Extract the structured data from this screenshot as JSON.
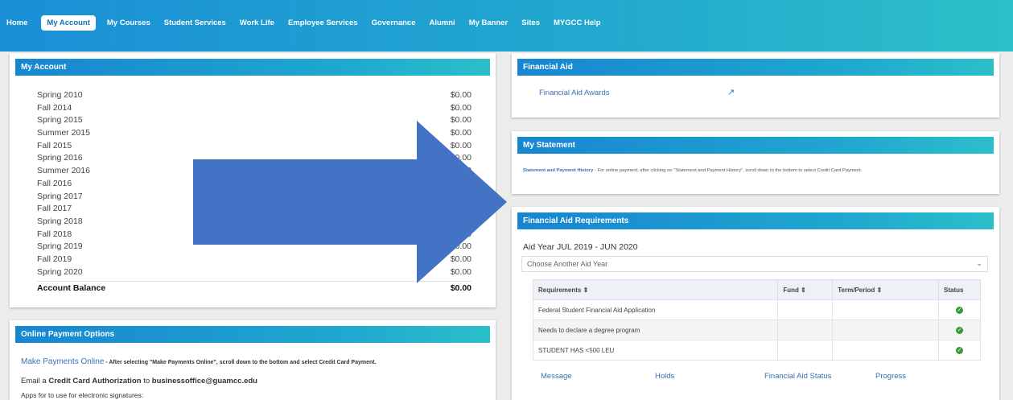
{
  "nav": [
    "Home",
    "My Account",
    "My Courses",
    "Student Services",
    "Work Life",
    "Employee Services",
    "Governance",
    "Alumni",
    "My Banner",
    "Sites",
    "MYGCC Help"
  ],
  "nav_active": "My Account",
  "account": {
    "title": "My Account",
    "terms": [
      {
        "term": "Spring 2010",
        "amount": "$0.00"
      },
      {
        "term": "Fall 2014",
        "amount": "$0.00"
      },
      {
        "term": "Spring 2015",
        "amount": "$0.00"
      },
      {
        "term": "Summer 2015",
        "amount": "$0.00"
      },
      {
        "term": "Fall 2015",
        "amount": "$0.00"
      },
      {
        "term": "Spring 2016",
        "amount": "$0.00"
      },
      {
        "term": "Summer 2016",
        "amount": "$0.00"
      },
      {
        "term": "Fall 2016",
        "amount": "$0.00"
      },
      {
        "term": "Spring 2017",
        "amount": "$0.00"
      },
      {
        "term": "Fall 2017",
        "amount": "$0.00"
      },
      {
        "term": "Spring 2018",
        "amount": "$0.00"
      },
      {
        "term": "Fall 2018",
        "amount": "$0.00"
      },
      {
        "term": "Spring 2019",
        "amount": "$0.00"
      },
      {
        "term": "Fall 2019",
        "amount": "$0.00"
      },
      {
        "term": "Spring 2020",
        "amount": "$0.00"
      }
    ],
    "balance_label": "Account Balance",
    "balance_value": "$0.00"
  },
  "payment": {
    "title": "Online Payment Options",
    "make_payments_link": "Make Payments Online",
    "make_payments_note": " - After selecting \"Make Payments Online\", scroll down to the bottom and select Credit Card Payment.",
    "email_prefix": "Email a ",
    "email_bold": "Credit Card Authorization",
    "email_mid": " to ",
    "email_address": "businessoffice@guamcc.edu",
    "apps_text": "Apps for to use for electronic signatures:"
  },
  "financial_aid": {
    "title": "Financial Aid",
    "awards_link": "Financial Aid Awards"
  },
  "statement": {
    "title": "My Statement",
    "link": "Statement and Payment History",
    "note": " - For online payment, after clicking on \"Statement and Payment History\", scroll down to the bottom to select Credit Card Payment."
  },
  "requirements": {
    "title": "Financial Aid Requirements",
    "aid_year": "Aid Year JUL 2019 - JUN 2020",
    "choose_placeholder": "Choose Another Aid Year",
    "columns": [
      "Requirements ⇕",
      "Fund ⇕",
      "Term/Period ⇕",
      "Status"
    ],
    "rows": [
      {
        "req": "Federal Student Financial Aid Application",
        "fund": "",
        "term": "",
        "status": "✓"
      },
      {
        "req": "Needs to declare a degree program",
        "fund": "",
        "term": "",
        "status": "✓"
      },
      {
        "req": "STUDENT HAS <500 LEU",
        "fund": "",
        "term": "",
        "status": "✓"
      }
    ],
    "links": [
      "Message",
      "Holds",
      "Financial Aid Status",
      "Progress"
    ]
  },
  "colors": {
    "header": "#1a8fd6",
    "panel_head": "#1786d1",
    "arrow": "#4472c4",
    "link": "#3a6fb5"
  }
}
